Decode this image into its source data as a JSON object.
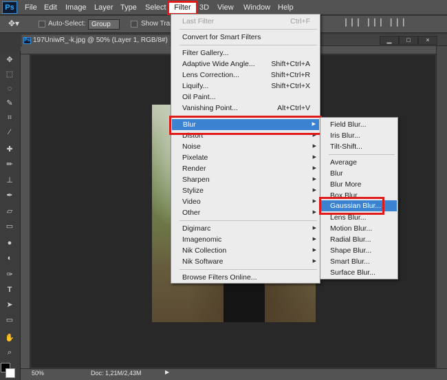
{
  "app": {
    "logo": "Ps",
    "accent": "#31a8ff",
    "highlight": "#e01919"
  },
  "menubar": {
    "items": [
      "File",
      "Edit",
      "Image",
      "Layer",
      "Type",
      "Select",
      "Filter",
      "3D",
      "View",
      "Window",
      "Help"
    ]
  },
  "options": {
    "auto_select": "Auto-Select:",
    "group": "Group",
    "show_transform": "Show Tran"
  },
  "document": {
    "tab_title": "197UniwR_-k.jpg @ 50% (Layer 1, RGB/8#) *",
    "close": "×"
  },
  "status": {
    "zoom": "50%",
    "doc": "Doc: 1,21M/2,43M"
  },
  "filter_menu": {
    "last_filter": {
      "label": "Last Filter",
      "shortcut": "Ctrl+F"
    },
    "convert": "Convert for Smart Filters",
    "items_a": [
      {
        "label": "Filter Gallery...",
        "shortcut": ""
      },
      {
        "label": "Adaptive Wide Angle...",
        "shortcut": "Shift+Ctrl+A"
      },
      {
        "label": "Lens Correction...",
        "shortcut": "Shift+Ctrl+R"
      },
      {
        "label": "Liquify...",
        "shortcut": "Shift+Ctrl+X"
      },
      {
        "label": "Oil Paint...",
        "shortcut": ""
      },
      {
        "label": "Vanishing Point...",
        "shortcut": "Alt+Ctrl+V"
      }
    ],
    "items_b": [
      "Blur",
      "Distort",
      "Noise",
      "Pixelate",
      "Render",
      "Sharpen",
      "Stylize",
      "Video",
      "Other"
    ],
    "items_c": [
      "Digimarc",
      "Imagenomic",
      "Nik Collection",
      "Nik Software"
    ],
    "browse": "Browse Filters Online..."
  },
  "blur_menu": {
    "group1": [
      "Field Blur...",
      "Iris Blur...",
      "Tilt-Shift..."
    ],
    "group2": [
      "Average",
      "Blur",
      "Blur More",
      "Box Blur...",
      "Gaussian Blur...",
      "Lens Blur...",
      "Motion Blur...",
      "Radial Blur...",
      "Shape Blur...",
      "Smart Blur...",
      "Surface Blur..."
    ]
  }
}
